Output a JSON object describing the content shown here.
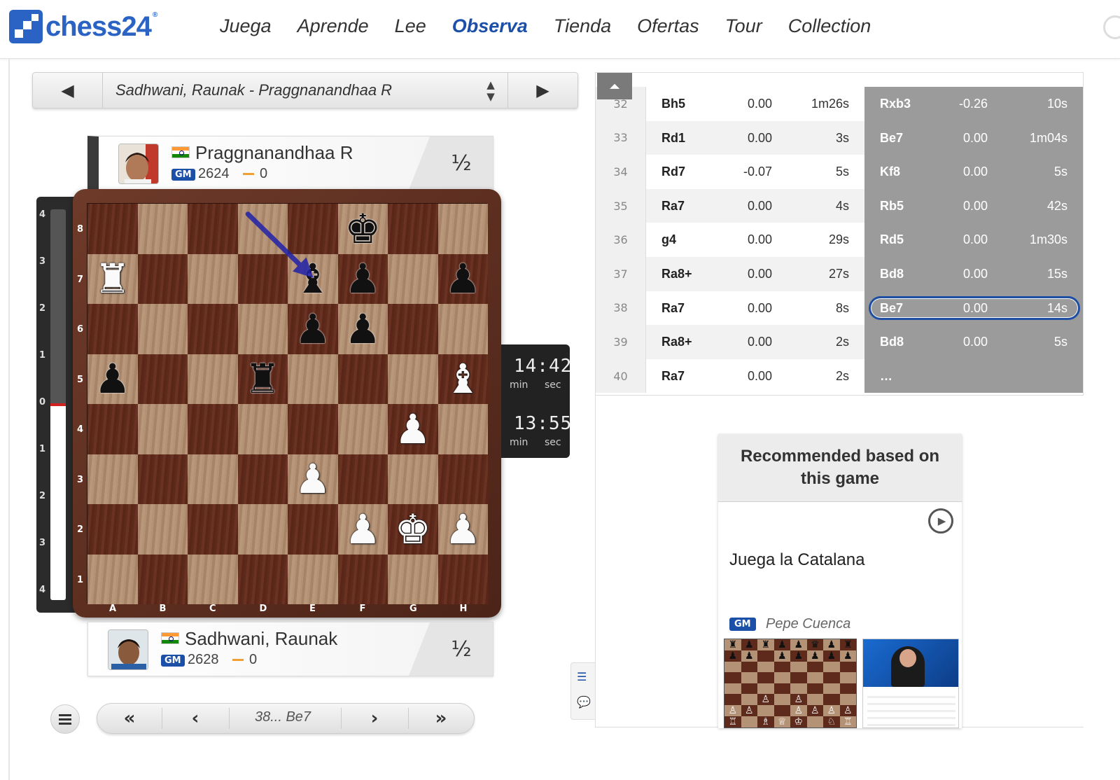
{
  "header": {
    "logo_text": "chess24",
    "logo_mark": "®",
    "nav": [
      "Juega",
      "Aprende",
      "Lee",
      "Observa",
      "Tienda",
      "Ofertas",
      "Tour",
      "Collection"
    ],
    "active_nav": "Observa"
  },
  "game_selector": {
    "title": "Sadhwani, Raunak - Praggnanandhaa R",
    "prev_icon": "triangle-left-icon",
    "next_icon": "triangle-right-icon"
  },
  "players": {
    "top": {
      "name": "Praggnanandhaa R",
      "title": "GM",
      "rating": "2624",
      "score": "0",
      "result": "½",
      "flag": "india-flag-icon"
    },
    "bottom": {
      "name": "Sadhwani, Raunak",
      "title": "GM",
      "rating": "2628",
      "score": "0",
      "result": "½",
      "flag": "india-flag-icon"
    }
  },
  "evaluation": {
    "labels": [
      "4",
      "3",
      "2",
      "1",
      "0",
      "1",
      "2",
      "3",
      "4"
    ],
    "value": 0.0
  },
  "board": {
    "files": [
      "A",
      "B",
      "C",
      "D",
      "E",
      "F",
      "G",
      "H"
    ],
    "ranks": [
      "8",
      "7",
      "6",
      "5",
      "4",
      "3",
      "2",
      "1"
    ],
    "pieces": [
      {
        "sq": "f8",
        "p": "k"
      },
      {
        "sq": "a7",
        "p": "R"
      },
      {
        "sq": "e7",
        "p": "b"
      },
      {
        "sq": "f7",
        "p": "p"
      },
      {
        "sq": "h7",
        "p": "p"
      },
      {
        "sq": "e6",
        "p": "p"
      },
      {
        "sq": "f6",
        "p": "p"
      },
      {
        "sq": "a5",
        "p": "p"
      },
      {
        "sq": "d5",
        "p": "r"
      },
      {
        "sq": "h5",
        "p": "B"
      },
      {
        "sq": "g4",
        "p": "P"
      },
      {
        "sq": "e3",
        "p": "P"
      },
      {
        "sq": "f2",
        "p": "P"
      },
      {
        "sq": "g2",
        "p": "K"
      },
      {
        "sq": "h2",
        "p": "P"
      }
    ],
    "last_move_arrow": {
      "from": "d8",
      "to": "e7",
      "color": "#2222aa"
    }
  },
  "clocks": {
    "top": {
      "time": "14:42",
      "unit_min": "min",
      "unit_sec": "sec"
    },
    "bottom": {
      "time": "13:55",
      "unit_min": "min",
      "unit_sec": "sec"
    }
  },
  "controls": {
    "current_move": "38... Be7",
    "first_icon": "double-chevron-left-icon",
    "prev_icon": "chevron-left-icon",
    "next_icon": "chevron-right-icon",
    "last_icon": "double-chevron-right-icon",
    "menu_icon": "hamburger-menu-icon"
  },
  "moves": [
    {
      "n": "32",
      "w": "Bh5",
      "we": "0.00",
      "wt": "1m26s",
      "b": "Rxb3",
      "be": "-0.26",
      "bt": "10s"
    },
    {
      "n": "33",
      "w": "Rd1",
      "we": "0.00",
      "wt": "3s",
      "b": "Be7",
      "be": "0.00",
      "bt": "1m04s"
    },
    {
      "n": "34",
      "w": "Rd7",
      "we": "-0.07",
      "wt": "5s",
      "b": "Kf8",
      "be": "0.00",
      "bt": "5s"
    },
    {
      "n": "35",
      "w": "Ra7",
      "we": "0.00",
      "wt": "4s",
      "b": "Rb5",
      "be": "0.00",
      "bt": "42s"
    },
    {
      "n": "36",
      "w": "g4",
      "we": "0.00",
      "wt": "29s",
      "b": "Rd5",
      "be": "0.00",
      "bt": "1m30s"
    },
    {
      "n": "37",
      "w": "Ra8+",
      "we": "0.00",
      "wt": "27s",
      "b": "Bd8",
      "be": "0.00",
      "bt": "15s"
    },
    {
      "n": "38",
      "w": "Ra7",
      "we": "0.00",
      "wt": "8s",
      "b": "Be7",
      "be": "0.00",
      "bt": "14s",
      "current": true
    },
    {
      "n": "39",
      "w": "Ra8+",
      "we": "0.00",
      "wt": "2s",
      "b": "Bd8",
      "be": "0.00",
      "bt": "5s"
    },
    {
      "n": "40",
      "w": "Ra7",
      "we": "0.00",
      "wt": "2s",
      "b": "…",
      "be": "",
      "bt": ""
    }
  ],
  "recommended": {
    "heading": "Recommended based on this game",
    "title": "Juega la Catalana",
    "author_title": "GM",
    "author": "Pepe Cuenca",
    "play_icon": "play-circle-icon"
  },
  "side_buttons": [
    "list-icon",
    "chat-icon"
  ],
  "colors": {
    "accent": "#1c4fa8",
    "highlight": "#1e4fa3",
    "black_moves_bg": "#9b9b9b"
  }
}
